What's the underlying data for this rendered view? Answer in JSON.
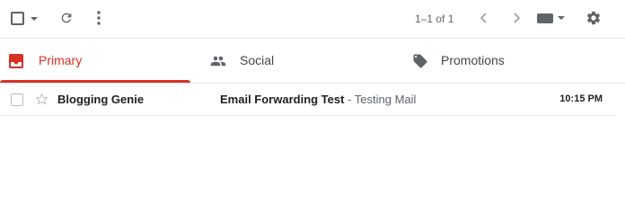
{
  "toolbar": {
    "select_icon": "checkbox-outline-icon",
    "select_menu_icon": "caret-down-icon",
    "refresh_icon": "refresh-icon",
    "more_icon": "more-vert-icon",
    "pagination_text": "1–1 of 1",
    "prev_icon": "chevron-left-icon",
    "next_icon": "chevron-right-icon",
    "input_tools_icon": "keyboard-icon",
    "settings_icon": "gear-icon"
  },
  "tabs": [
    {
      "label": "Primary",
      "icon": "inbox-icon",
      "selected": true
    },
    {
      "label": "Social",
      "icon": "people-icon",
      "selected": false
    },
    {
      "label": "Promotions",
      "icon": "tag-icon",
      "selected": false
    }
  ],
  "emails": [
    {
      "sender": "Blogging Genie",
      "subject": "Email Forwarding Test",
      "separator": " - ",
      "snippet": "Testing Mail",
      "time": "10:15 PM",
      "starred": false,
      "unread": true
    }
  ],
  "colors": {
    "accent": "#d93025",
    "icon": "#5f6368",
    "divider": "#e5e5e5"
  }
}
